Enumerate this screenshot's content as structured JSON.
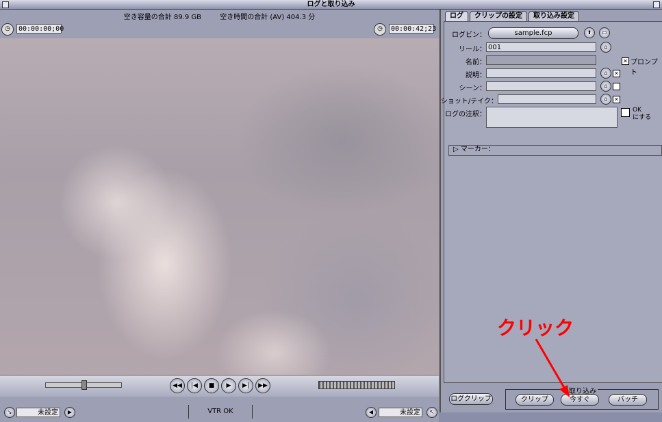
{
  "window": {
    "title": "ログと取り込み"
  },
  "info": {
    "free_space": "空き容量の合計  89.9 GB",
    "free_time": "空き時間の合計  (AV) 404.3 分"
  },
  "timecodes": {
    "left": "00:00:00;00",
    "right": "00:00:42;23"
  },
  "mark": {
    "in_value": "未設定",
    "out_value": "未設定"
  },
  "vtr_status": "VTR OK",
  "tabs": [
    "ログ",
    "クリップの設定",
    "取り込み設定"
  ],
  "log": {
    "logbin_label": "ログビン：",
    "logbin_value": "sample.fcp",
    "reel_label": "リール：",
    "reel_value": "001",
    "name_label": "名前：",
    "prompt_label": "プロンプト",
    "desc_label": "説明：",
    "scene_label": "シーン：",
    "shot_label": "ショット/テイク：",
    "note_label": "ログの注釈：",
    "ok_label": "OK",
    "ok_label2": "にする",
    "marker_label": "マーカー："
  },
  "buttons": {
    "log_clip": "ログクリップ",
    "clip": "クリップ",
    "now": "今すぐ",
    "batch": "バッチ",
    "capture_group": "取り込み"
  },
  "annotation": {
    "text": "クリック",
    "color": "#ff0000"
  }
}
